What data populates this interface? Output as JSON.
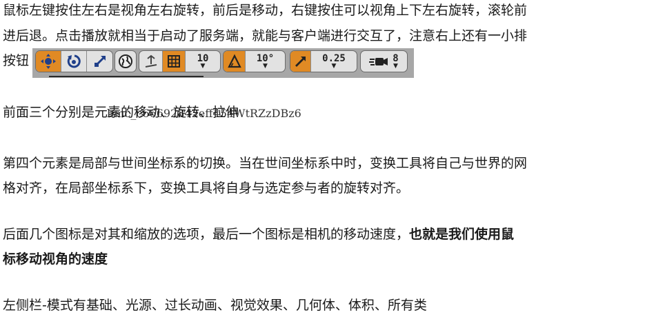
{
  "paragraph1": {
    "line1": "鼠标左键按住左右是视角左右旋转，前后是移动，右键按住可以视角上下左右旋转，滚轮前",
    "line2": "进后退。点击播放就相当于启动了服务端，就能与客户端进行交互了，注意右上还有一小排",
    "line3": "按钮"
  },
  "toolbar": {
    "grid_snap_value": "10",
    "angle_snap_value": "10°",
    "scale_snap_value": "0.25",
    "camera_speed_value": "8",
    "icons": [
      "move-icon",
      "rotate-icon",
      "scale-icon",
      "world-local-icon",
      "surface-snap-icon",
      "grid-icon",
      "angle-icon",
      "scale-snap-icon",
      "camera-speed-icon"
    ],
    "accent": "#e08a24"
  },
  "paragraph2": {
    "text": "前面三个分别是元素的移动、旋转、拉伸"
  },
  "overlay": {
    "text": "bmc_c66692842eff454WtRZzDBz6"
  },
  "paragraph3": {
    "line1": "第四个元素是局部与世间坐标系的切换。当在世间坐标系中时，变换工具将自己与世界的网",
    "line2": "格对齐，在局部坐标系下，变换工具将自身与选定参与者的旋转对齐。"
  },
  "paragraph4": {
    "line1": "后面几个图标是对其和缩放的选项，最后一个图标是相机的移动速度，",
    "line1_bold": "也就是我们使用鼠",
    "line2_bold": "标移动视角的速度"
  },
  "paragraph5": {
    "text": "左侧栏-模式有基础、光源、过长动画、视觉效果、几何体、体积、所有类"
  }
}
